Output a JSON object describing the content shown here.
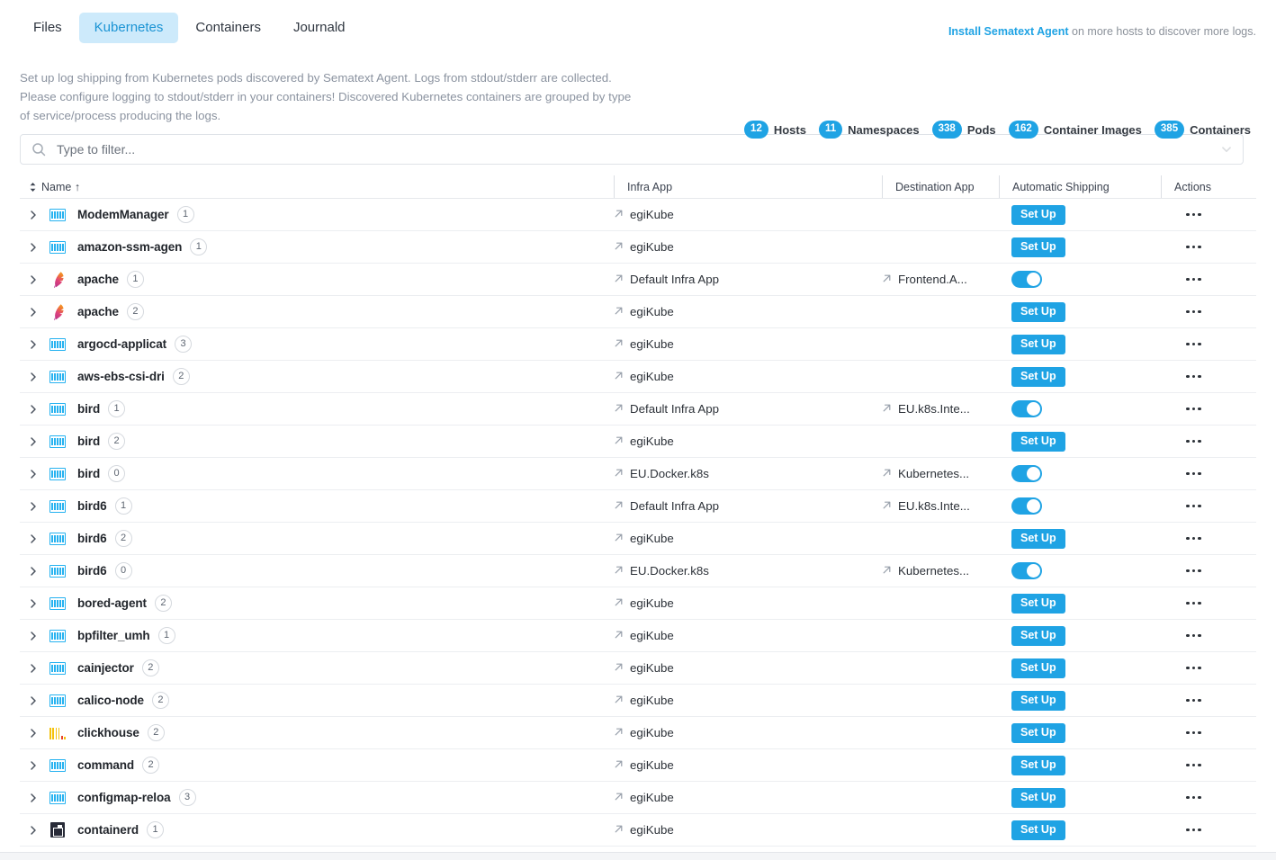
{
  "tabs": [
    {
      "label": "Files",
      "active": false
    },
    {
      "label": "Kubernetes",
      "active": true
    },
    {
      "label": "Containers",
      "active": false
    },
    {
      "label": "Journald",
      "active": false
    }
  ],
  "install_note": {
    "link_text": "Install Sematext Agent",
    "rest_text": " on more hosts to discover more logs."
  },
  "description": "Set up log shipping from Kubernetes pods discovered by Sematext Agent. Logs from stdout/stderr are collected. Please configure logging to stdout/stderr in your containers! Discovered Kubernetes containers are grouped by type of service/process producing the logs.",
  "stats": [
    {
      "count": "12",
      "label": "Hosts"
    },
    {
      "count": "11",
      "label": "Namespaces"
    },
    {
      "count": "338",
      "label": "Pods"
    },
    {
      "count": "162",
      "label": "Container Images"
    },
    {
      "count": "385",
      "label": "Containers"
    }
  ],
  "filter": {
    "placeholder": "Type to filter...",
    "value": ""
  },
  "columns": {
    "name": "Name ↑",
    "infra_app": "Infra App",
    "destination_app": "Destination App",
    "automatic_shipping": "Automatic Shipping",
    "actions": "Actions"
  },
  "setup_label": "Set Up",
  "accent_color": "#1fa3e4",
  "active_tab_bg": "#cdeafb",
  "rows": [
    {
      "name": "ModemManager",
      "count": "1",
      "icon": "logs-icon",
      "infra_app": "egiKube",
      "destination_app": "",
      "shipping": "setup"
    },
    {
      "name": "amazon-ssm-agen",
      "count": "1",
      "icon": "logs-icon",
      "infra_app": "egiKube",
      "destination_app": "",
      "shipping": "setup"
    },
    {
      "name": "apache",
      "count": "1",
      "icon": "apache-icon",
      "infra_app": "Default Infra App",
      "destination_app": "Frontend.A...",
      "shipping": "on"
    },
    {
      "name": "apache",
      "count": "2",
      "icon": "apache-icon",
      "infra_app": "egiKube",
      "destination_app": "",
      "shipping": "setup"
    },
    {
      "name": "argocd-applicat",
      "count": "3",
      "icon": "logs-icon",
      "infra_app": "egiKube",
      "destination_app": "",
      "shipping": "setup"
    },
    {
      "name": "aws-ebs-csi-dri",
      "count": "2",
      "icon": "logs-icon",
      "infra_app": "egiKube",
      "destination_app": "",
      "shipping": "setup"
    },
    {
      "name": "bird",
      "count": "1",
      "icon": "logs-icon",
      "infra_app": "Default Infra App",
      "destination_app": "EU.k8s.Inte...",
      "shipping": "on"
    },
    {
      "name": "bird",
      "count": "2",
      "icon": "logs-icon",
      "infra_app": "egiKube",
      "destination_app": "",
      "shipping": "setup"
    },
    {
      "name": "bird",
      "count": "0",
      "icon": "logs-icon",
      "infra_app": "EU.Docker.k8s",
      "destination_app": "Kubernetes...",
      "shipping": "on"
    },
    {
      "name": "bird6",
      "count": "1",
      "icon": "logs-icon",
      "infra_app": "Default Infra App",
      "destination_app": "EU.k8s.Inte...",
      "shipping": "on"
    },
    {
      "name": "bird6",
      "count": "2",
      "icon": "logs-icon",
      "infra_app": "egiKube",
      "destination_app": "",
      "shipping": "setup"
    },
    {
      "name": "bird6",
      "count": "0",
      "icon": "logs-icon",
      "infra_app": "EU.Docker.k8s",
      "destination_app": "Kubernetes...",
      "shipping": "on"
    },
    {
      "name": "bored-agent",
      "count": "2",
      "icon": "logs-icon",
      "infra_app": "egiKube",
      "destination_app": "",
      "shipping": "setup"
    },
    {
      "name": "bpfilter_umh",
      "count": "1",
      "icon": "logs-icon",
      "infra_app": "egiKube",
      "destination_app": "",
      "shipping": "setup"
    },
    {
      "name": "cainjector",
      "count": "2",
      "icon": "logs-icon",
      "infra_app": "egiKube",
      "destination_app": "",
      "shipping": "setup"
    },
    {
      "name": "calico-node",
      "count": "2",
      "icon": "logs-icon",
      "infra_app": "egiKube",
      "destination_app": "",
      "shipping": "setup"
    },
    {
      "name": "clickhouse",
      "count": "2",
      "icon": "clickhouse-icon",
      "infra_app": "egiKube",
      "destination_app": "",
      "shipping": "setup"
    },
    {
      "name": "command",
      "count": "2",
      "icon": "logs-icon",
      "infra_app": "egiKube",
      "destination_app": "",
      "shipping": "setup"
    },
    {
      "name": "configmap-reloa",
      "count": "3",
      "icon": "logs-icon",
      "infra_app": "egiKube",
      "destination_app": "",
      "shipping": "setup"
    },
    {
      "name": "containerd",
      "count": "1",
      "icon": "containerd-icon",
      "infra_app": "egiKube",
      "destination_app": "",
      "shipping": "setup"
    }
  ]
}
